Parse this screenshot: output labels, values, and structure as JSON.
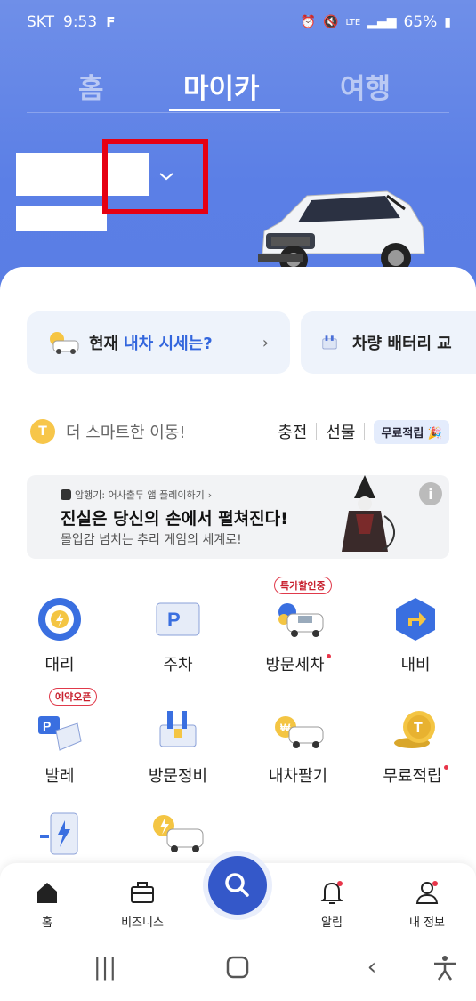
{
  "status_bar": {
    "carrier": "SKT",
    "time": "9:53",
    "f_icon": "F",
    "lte": "LTE",
    "battery": "65%"
  },
  "top_tabs": [
    "홈",
    "마이카",
    "여행"
  ],
  "promos": [
    {
      "label": "현재",
      "accent": "내차 시세는?",
      "chevron": "›"
    },
    {
      "label": "차량 배터리",
      "accent": "교"
    }
  ],
  "smart": {
    "coin": "T",
    "text": "더 스마트한 이동!",
    "charge": "충전",
    "gift": "선물",
    "free_badge": "무료적립"
  },
  "ad": {
    "small": "암행기: 어사출두 앱 플레이하기",
    "small_chevron": "›",
    "title": "진실은 당신의 손에서 펼쳐진다!",
    "sub": "몰입감 넘치는 추리 게임의 세계로!",
    "info": "i"
  },
  "grid": {
    "driver": "대리",
    "parking": "주차",
    "carwash": "방문세차",
    "carwash_badge": "특가할인중",
    "navi": "내비",
    "valet": "발레",
    "valet_badge": "예약오픈",
    "repair": "방문정비",
    "sellcar": "내차팔기",
    "freepoint": "무료적립"
  },
  "bottom_nav": {
    "home": "홈",
    "business": "비즈니스",
    "alarm": "알림",
    "myinfo": "내 정보"
  },
  "colors": {
    "hero_blue": "#5b7fe6",
    "accent_blue": "#3366dd",
    "red_highlight": "#e60012"
  }
}
